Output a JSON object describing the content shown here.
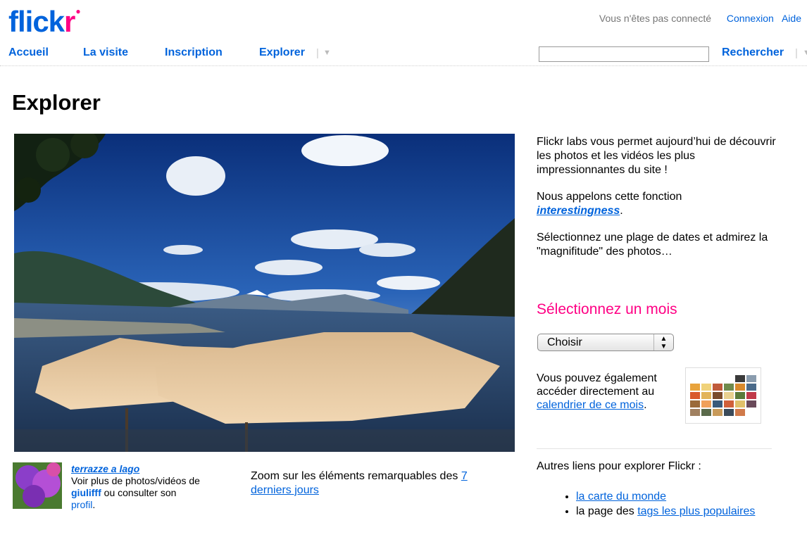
{
  "brand": {
    "logo_part1": "flick",
    "logo_part2": "r",
    "logo_dot": "●"
  },
  "topbar": {
    "status": "Vous n'êtes pas connecté",
    "login": "Connexion",
    "help": "Aide"
  },
  "nav": {
    "items": [
      {
        "label": "Accueil"
      },
      {
        "label": "La visite"
      },
      {
        "label": "Inscription"
      },
      {
        "label": "Explorer"
      }
    ],
    "search_button": "Rechercher",
    "search_placeholder": "",
    "search_value": ""
  },
  "page": {
    "title": "Explorer"
  },
  "photo": {
    "title": "terrazze a lago",
    "more_prefix": "Voir plus de photos/vidéos de",
    "owner": "giulifff",
    "more_mid": "ou consulter son",
    "profile_link": "profil",
    "more_suffix": "."
  },
  "zoom": {
    "text": "Zoom sur les éléments remarquables des",
    "link": "7 derniers jours"
  },
  "sidebar": {
    "intro": "Flickr labs vous permet aujourd’hui de découvrir les photos et les vidéos les plus impressionnantes du site !",
    "interest_prefix": "Nous appelons cette fonction",
    "interest_link": "interestingness",
    "interest_suffix": ".",
    "dates_text": "Sélectionnez une plage de dates et admirez la \"magnifitude\" des photos…",
    "month_heading": "Sélectionnez un mois",
    "select_value": "Choisir",
    "calendar_prefix": "Vous pouvez également accéder directement au",
    "calendar_link": "calendrier de ce mois",
    "calendar_suffix": ".",
    "other_heading": "Autres liens pour explorer Flickr :",
    "links": [
      {
        "prefix": "",
        "link": "la carte du monde"
      },
      {
        "prefix": "la page des",
        "link": "tags les plus populaires"
      }
    ]
  },
  "colors": {
    "blue": "#0063dc",
    "pink": "#ff0084"
  }
}
